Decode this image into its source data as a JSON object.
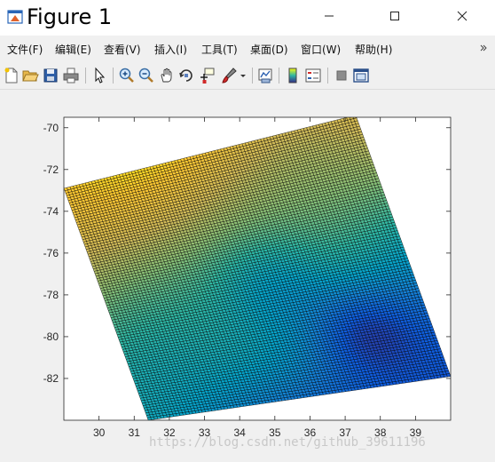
{
  "window": {
    "title": "Figure 1",
    "controls": {
      "minimize": "—",
      "maximize": "☐",
      "close": "✕"
    }
  },
  "menu": {
    "items": [
      {
        "id": "file",
        "label": "文件(F)"
      },
      {
        "id": "edit",
        "label": "编辑(E)"
      },
      {
        "id": "view",
        "label": "查看(V)"
      },
      {
        "id": "insert",
        "label": "插入(I)"
      },
      {
        "id": "tools",
        "label": "工具(T)"
      },
      {
        "id": "desktop",
        "label": "桌面(D)"
      },
      {
        "id": "window",
        "label": "窗口(W)"
      },
      {
        "id": "help",
        "label": "帮助(H)"
      }
    ],
    "overflow_icon": "overflow-arrow-icon"
  },
  "toolbar": {
    "buttons": [
      {
        "id": "new-figure",
        "icon": "new-file-icon"
      },
      {
        "id": "open-file",
        "icon": "open-folder-icon"
      },
      {
        "id": "save-figure",
        "icon": "save-disk-icon"
      },
      {
        "id": "print-figure",
        "icon": "printer-icon"
      },
      {
        "id": "edit-plot",
        "icon": "pointer-arrow-icon"
      },
      {
        "id": "zoom-in",
        "icon": "zoom-in-icon"
      },
      {
        "id": "zoom-out",
        "icon": "zoom-out-icon"
      },
      {
        "id": "pan",
        "icon": "hand-pan-icon"
      },
      {
        "id": "rotate-3d",
        "icon": "rotate-3d-icon"
      },
      {
        "id": "data-cursor",
        "icon": "data-cursor-icon"
      },
      {
        "id": "brush",
        "icon": "brush-icon"
      },
      {
        "id": "link-plot",
        "icon": "link-plot-icon"
      },
      {
        "id": "colorbar",
        "icon": "colorbar-icon"
      },
      {
        "id": "legend",
        "icon": "legend-icon"
      },
      {
        "id": "hide-plot-tools",
        "icon": "hide-tools-icon"
      },
      {
        "id": "show-plot-tools",
        "icon": "show-tools-icon"
      }
    ]
  },
  "chart_data": {
    "type": "surface",
    "title": "",
    "xlabel": "",
    "ylabel": "",
    "view": "2-D top view (x right, y up)",
    "xlim": [
      29.0,
      40.0
    ],
    "ylim": [
      -84.0,
      -69.5
    ],
    "xticks": [
      30,
      31,
      32,
      33,
      34,
      35,
      36,
      37,
      38,
      39
    ],
    "yticks": [
      -70,
      -72,
      -74,
      -76,
      -78,
      -80,
      -82
    ],
    "xtick_labels": [
      "30",
      "31",
      "32",
      "33",
      "34",
      "35",
      "36",
      "37",
      "38",
      "39"
    ],
    "ytick_labels": [
      "-70",
      "-72",
      "-74",
      "-76",
      "-78",
      "-80",
      "-82"
    ],
    "surface_corners": {
      "top_left": [
        29.0,
        -72.9
      ],
      "top_right": [
        37.3,
        -69.4
      ],
      "bottom_right": [
        40.0,
        -81.9
      ],
      "bottom_left": [
        31.4,
        -84.0
      ]
    },
    "mesh": {
      "rows": 95,
      "cols": 95,
      "edge_color": "#000000"
    },
    "colormap": "parula",
    "colormap_stops": [
      "#352a87",
      "#0f5cdd",
      "#1481d6",
      "#06a4ca",
      "#2eb7a4",
      "#87bf77",
      "#d1bb59",
      "#fec832",
      "#f9fb0e"
    ],
    "trend": "highest values toward upper-left (yellow/gold), lowest values toward lower-right (dark blue)",
    "grid": false,
    "legend": "none"
  },
  "watermark": "https://blog.csdn.net/github_39611196"
}
